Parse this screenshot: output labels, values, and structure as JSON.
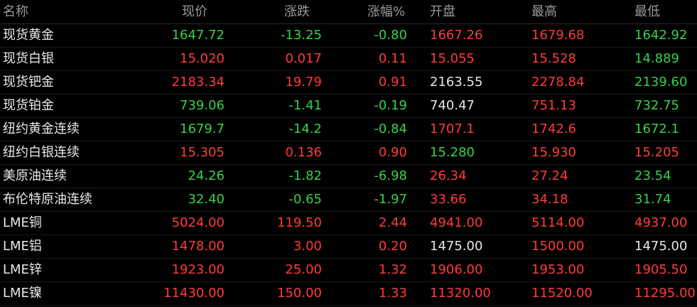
{
  "headers": [
    "名称",
    "现价",
    "涨跌",
    "涨幅%",
    "开盘",
    "最高",
    "最低"
  ],
  "rows": [
    {
      "name": "现货黄金",
      "price": "1647.72",
      "change": "-13.25",
      "pct": "-0.80",
      "open": "1667.26",
      "high": "1679.68",
      "low": "1642.92"
    },
    {
      "name": "现货白银",
      "price": "15.020",
      "change": "0.017",
      "pct": "0.11",
      "open": "15.055",
      "high": "15.528",
      "low": "14.889"
    },
    {
      "name": "现货钯金",
      "price": "2183.34",
      "change": "19.79",
      "pct": "0.91",
      "open": "2163.55",
      "high": "2278.84",
      "low": "2139.60"
    },
    {
      "name": "现货铂金",
      "price": "739.06",
      "change": "-1.41",
      "pct": "-0.19",
      "open": "740.47",
      "high": "751.13",
      "low": "732.75"
    },
    {
      "name": "纽约黄金连续",
      "price": "1679.7",
      "change": "-14.2",
      "pct": "-0.84",
      "open": "1707.1",
      "high": "1742.6",
      "low": "1672.1"
    },
    {
      "name": "纽约白银连续",
      "price": "15.305",
      "change": "0.136",
      "pct": "0.90",
      "open": "15.280",
      "high": "15.930",
      "low": "15.205"
    },
    {
      "name": "美原油连续",
      "price": "24.26",
      "change": "-1.82",
      "pct": "-6.98",
      "open": "26.34",
      "high": "27.24",
      "low": "23.54"
    },
    {
      "name": "布伦特原油连续",
      "price": "32.40",
      "change": "-0.65",
      "pct": "-1.97",
      "open": "33.66",
      "high": "34.18",
      "low": "31.74"
    },
    {
      "name": "LME铜",
      "price": "5024.00",
      "change": "119.50",
      "pct": "2.44",
      "open": "4941.00",
      "high": "5114.00",
      "low": "4937.00"
    },
    {
      "name": "LME铝",
      "price": "1478.00",
      "change": "3.00",
      "pct": "0.20",
      "open": "1475.00",
      "high": "1500.00",
      "low": "1475.00"
    },
    {
      "name": "LME锌",
      "price": "1923.00",
      "change": "25.00",
      "pct": "1.32",
      "open": "1906.00",
      "high": "1953.00",
      "low": "1905.50"
    },
    {
      "name": "LME镍",
      "price": "11430.00",
      "change": "150.00",
      "pct": "1.33",
      "open": "11320.00",
      "high": "11520.00",
      "low": "11295.00"
    }
  ],
  "colors": {
    "up": "#ff3b3b",
    "down": "#35d24a",
    "flat": "#e6e6e6",
    "header_text": "#9a9a9a",
    "background": "#000000"
  },
  "cell_colors": [
    {
      "price": "down",
      "change": "down",
      "pct": "down",
      "open": "up",
      "high": "up",
      "low": "down"
    },
    {
      "price": "up",
      "change": "up",
      "pct": "up",
      "open": "up",
      "high": "up",
      "low": "down"
    },
    {
      "price": "up",
      "change": "up",
      "pct": "up",
      "open": "flat",
      "high": "up",
      "low": "down"
    },
    {
      "price": "down",
      "change": "down",
      "pct": "down",
      "open": "flat",
      "high": "up",
      "low": "down"
    },
    {
      "price": "down",
      "change": "down",
      "pct": "down",
      "open": "up",
      "high": "up",
      "low": "down"
    },
    {
      "price": "up",
      "change": "up",
      "pct": "up",
      "open": "down",
      "high": "up",
      "low": "up"
    },
    {
      "price": "down",
      "change": "down",
      "pct": "down",
      "open": "up",
      "high": "up",
      "low": "down"
    },
    {
      "price": "down",
      "change": "down",
      "pct": "down",
      "open": "up",
      "high": "up",
      "low": "down"
    },
    {
      "price": "up",
      "change": "up",
      "pct": "up",
      "open": "up",
      "high": "up",
      "low": "up"
    },
    {
      "price": "up",
      "change": "up",
      "pct": "up",
      "open": "flat",
      "high": "up",
      "low": "flat"
    },
    {
      "price": "up",
      "change": "up",
      "pct": "up",
      "open": "up",
      "high": "up",
      "low": "up"
    },
    {
      "price": "up",
      "change": "up",
      "pct": "up",
      "open": "up",
      "high": "up",
      "low": "up"
    }
  ]
}
